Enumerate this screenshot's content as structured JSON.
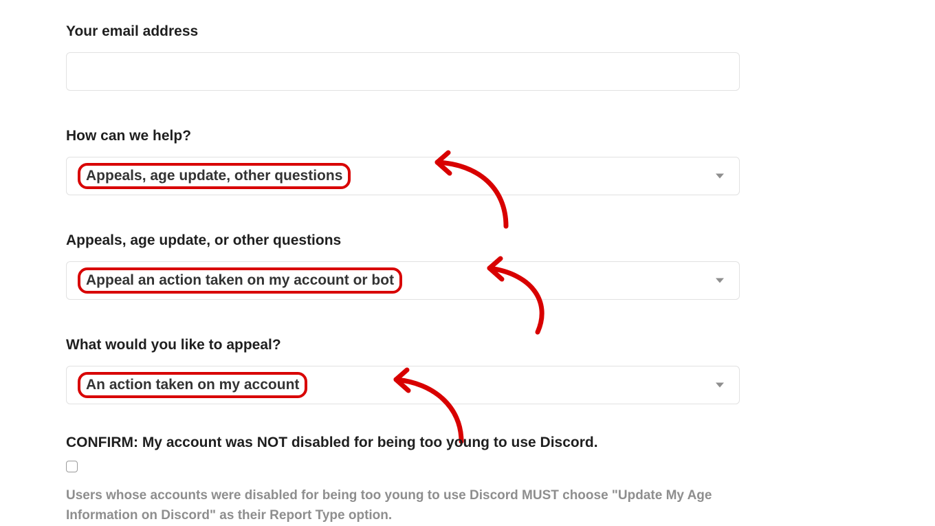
{
  "email": {
    "label": "Your email address",
    "value": ""
  },
  "help": {
    "label": "How can we help?",
    "selected": "Appeals, age update, other questions"
  },
  "sub1": {
    "label": "Appeals, age update, or other questions",
    "selected": "Appeal an action taken on my account or bot"
  },
  "sub2": {
    "label": "What would you like to appeal?",
    "selected": "An action taken on my account"
  },
  "confirm": {
    "label": "CONFIRM: My account was NOT disabled for being too young to use Discord.",
    "checked": false,
    "help": "Users whose accounts were disabled for being too young to use Discord MUST choose \"Update My Age Information on Discord\" as their Report Type option."
  },
  "annotation_color": "#d80000"
}
